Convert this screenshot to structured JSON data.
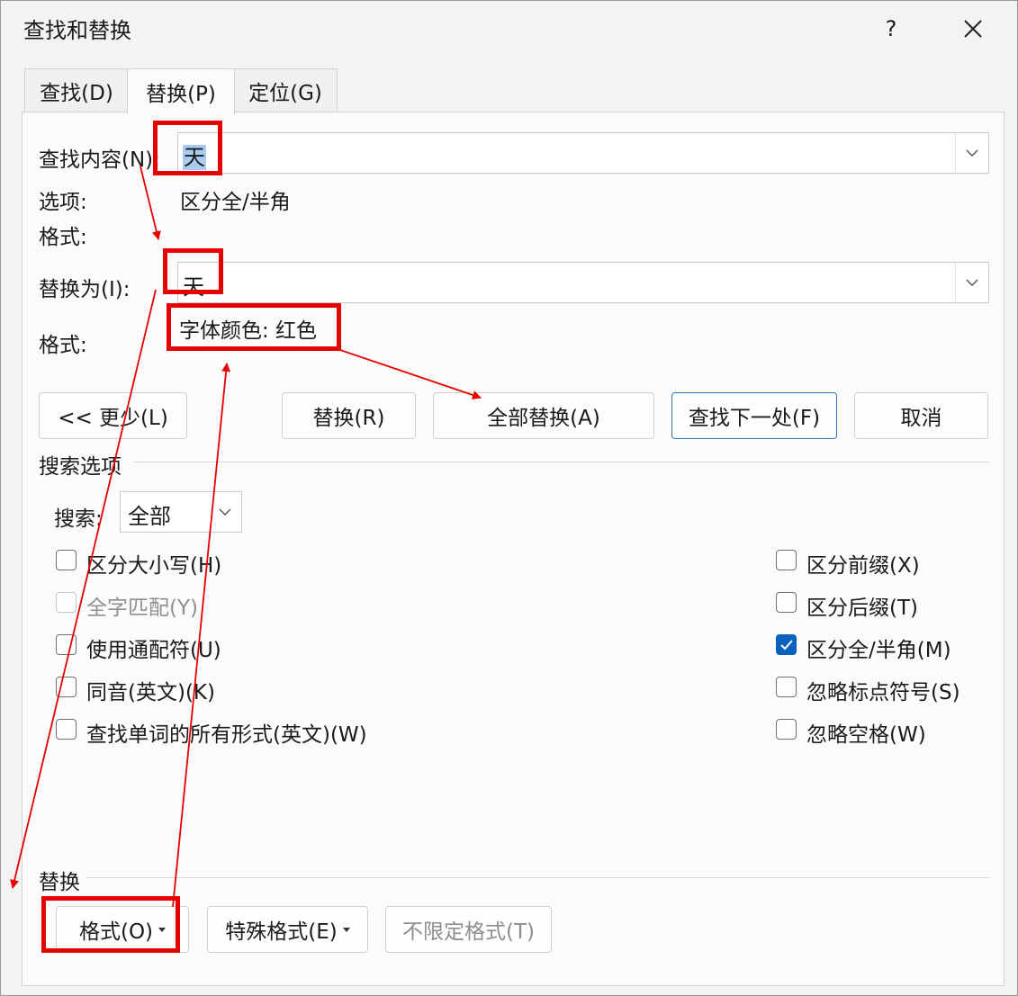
{
  "window": {
    "title": "查找和替换",
    "help_label": "?",
    "close_icon": "close-icon"
  },
  "tabs": [
    {
      "label": "查找(D)",
      "active": false
    },
    {
      "label": "替换(P)",
      "active": true
    },
    {
      "label": "定位(G)",
      "active": false
    }
  ],
  "find": {
    "label": "查找内容(N):",
    "value": "天",
    "options_label": "选项:",
    "options_value": "区分全/半角",
    "format_label": "格式:"
  },
  "replace": {
    "label": "替换为(I):",
    "value": "天",
    "format_label": "格式:",
    "format_value": "字体颜色: 红色"
  },
  "buttons": {
    "less": "<< 更少(L)",
    "replace": "替换(R)",
    "replace_all": "全部替换(A)",
    "find_next": "查找下一处(F)",
    "cancel": "取消"
  },
  "search_options": {
    "heading": "搜索选项",
    "search_label": "搜索:",
    "search_value": "全部",
    "left_checks": [
      {
        "label": "区分大小写(H)",
        "checked": false,
        "disabled": false
      },
      {
        "label": "全字匹配(Y)",
        "checked": false,
        "disabled": true
      },
      {
        "label": "使用通配符(U)",
        "checked": false,
        "disabled": false
      },
      {
        "label": "同音(英文)(K)",
        "checked": false,
        "disabled": false
      },
      {
        "label": "查找单词的所有形式(英文)(W)",
        "checked": false,
        "disabled": false
      }
    ],
    "right_checks": [
      {
        "label": "区分前缀(X)",
        "checked": false,
        "disabled": false
      },
      {
        "label": "区分后缀(T)",
        "checked": false,
        "disabled": false
      },
      {
        "label": "区分全/半角(M)",
        "checked": true,
        "disabled": false
      },
      {
        "label": "忽略标点符号(S)",
        "checked": false,
        "disabled": false
      },
      {
        "label": "忽略空格(W)",
        "checked": false,
        "disabled": false
      }
    ]
  },
  "replace_section": {
    "heading": "替换",
    "format_button": "格式(O)",
    "special_button": "特殊格式(E)",
    "no_format_button": "不限定格式(T)"
  },
  "annotation_color": "#e60000",
  "accent_color": "#0a62bd"
}
